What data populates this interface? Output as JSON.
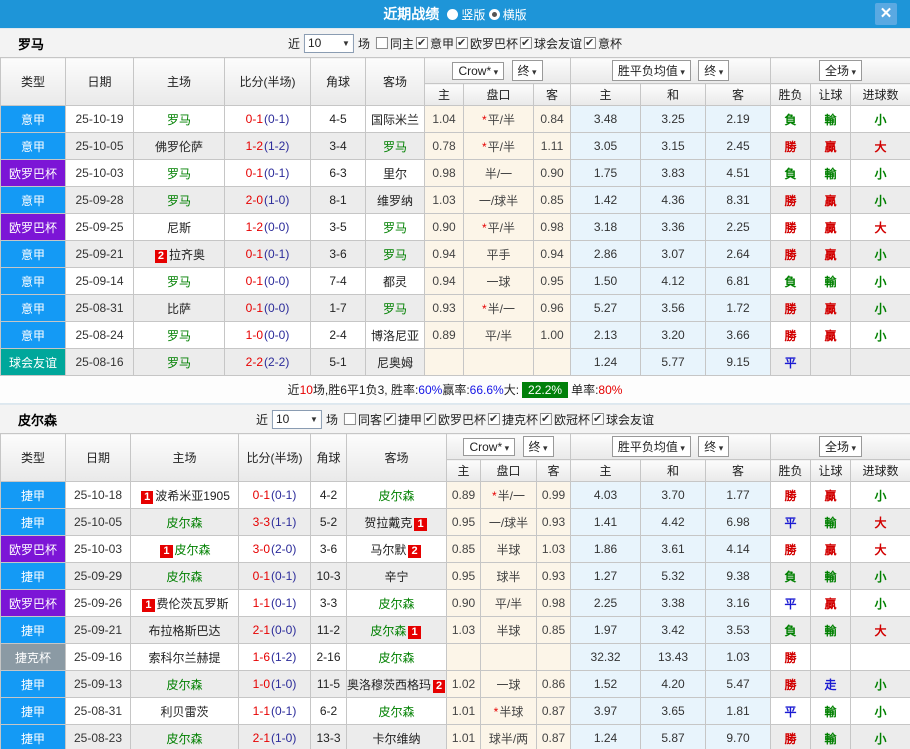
{
  "titlebar": {
    "title": "近期战绩",
    "layout_options": [
      {
        "label": "竖版",
        "checked": false
      },
      {
        "label": "横版",
        "checked": true
      }
    ],
    "close": "✕"
  },
  "table_header": {
    "type": "类型",
    "date": "日期",
    "home": "主场",
    "score": "比分(半场)",
    "corner": "角球",
    "away": "客场",
    "crow": "Crow*",
    "final": "终",
    "avg": "胜平负均值",
    "fullmatch": "全场",
    "h1": "主",
    "hcap": "盘口",
    "a1": "客",
    "h2": "主",
    "d": "和",
    "a2": "客",
    "wl": "胜负",
    "rg": "让球",
    "goals": "进球数"
  },
  "league_colors": {
    "意甲": "#149af5",
    "捷甲": "#149af5",
    "欧罗巴杯": "#7c15d6",
    "球会友谊": "#00a79b",
    "捷克杯": "#8b9aa4"
  },
  "result_colors": {
    "win": "#d20000",
    "lose": "#008000",
    "draw": "#1a1ad2"
  },
  "sections": [
    {
      "team": "罗马",
      "near": "近",
      "count": "10",
      "matches": "场",
      "filters": [
        {
          "label": "同主",
          "checked": false
        },
        {
          "label": "意甲",
          "checked": true
        },
        {
          "label": "欧罗巴杯",
          "checked": true
        },
        {
          "label": "球会友谊",
          "checked": true
        },
        {
          "label": "意杯",
          "checked": true
        }
      ],
      "rows": [
        {
          "league": "意甲",
          "date": "25-10-19",
          "home": {
            "name": "罗马",
            "green": true,
            "badge": ""
          },
          "ft": "0-1",
          "ht": "0-1",
          "corner": "4-5",
          "away": {
            "name": "国际米兰",
            "green": false,
            "badge": ""
          },
          "o1": "1.04",
          "star": true,
          "hcap": "平/半",
          "o2": "0.84",
          "a1": "3.48",
          "a2": "3.25",
          "a3": "2.19",
          "r1": "負",
          "r2": "輸",
          "r3": "小"
        },
        {
          "league": "意甲",
          "date": "25-10-05",
          "home": {
            "name": "佛罗伦萨",
            "green": false,
            "badge": ""
          },
          "ft": "1-2",
          "ht": "1-2",
          "corner": "3-4",
          "away": {
            "name": "罗马",
            "green": true,
            "badge": ""
          },
          "o1": "0.78",
          "star": true,
          "hcap": "平/半",
          "o2": "1.11",
          "a1": "3.05",
          "a2": "3.15",
          "a3": "2.45",
          "r1": "勝",
          "r2": "贏",
          "r3": "大"
        },
        {
          "league": "欧罗巴杯",
          "date": "25-10-03",
          "home": {
            "name": "罗马",
            "green": true,
            "badge": ""
          },
          "ft": "0-1",
          "ht": "0-1",
          "corner": "6-3",
          "away": {
            "name": "里尔",
            "green": false,
            "badge": ""
          },
          "o1": "0.98",
          "star": false,
          "hcap": "半/一",
          "o2": "0.90",
          "a1": "1.75",
          "a2": "3.83",
          "a3": "4.51",
          "r1": "負",
          "r2": "輸",
          "r3": "小"
        },
        {
          "league": "意甲",
          "date": "25-09-28",
          "home": {
            "name": "罗马",
            "green": true,
            "badge": ""
          },
          "ft": "2-0",
          "ht": "1-0",
          "corner": "8-1",
          "away": {
            "name": "维罗纳",
            "green": false,
            "badge": ""
          },
          "o1": "1.03",
          "star": false,
          "hcap": "一/球半",
          "o2": "0.85",
          "a1": "1.42",
          "a2": "4.36",
          "a3": "8.31",
          "r1": "勝",
          "r2": "贏",
          "r3": "小"
        },
        {
          "league": "欧罗巴杯",
          "date": "25-09-25",
          "home": {
            "name": "尼斯",
            "green": false,
            "badge": ""
          },
          "ft": "1-2",
          "ht": "0-0",
          "corner": "3-5",
          "away": {
            "name": "罗马",
            "green": true,
            "badge": ""
          },
          "o1": "0.90",
          "star": true,
          "hcap": "平/半",
          "o2": "0.98",
          "a1": "3.18",
          "a2": "3.36",
          "a3": "2.25",
          "r1": "勝",
          "r2": "贏",
          "r3": "大"
        },
        {
          "league": "意甲",
          "date": "25-09-21",
          "home": {
            "name": "拉齐奥",
            "green": false,
            "badge": "2"
          },
          "ft": "0-1",
          "ht": "0-1",
          "corner": "3-6",
          "away": {
            "name": "罗马",
            "green": true,
            "badge": ""
          },
          "o1": "0.94",
          "star": false,
          "hcap": "平手",
          "o2": "0.94",
          "a1": "2.86",
          "a2": "3.07",
          "a3": "2.64",
          "r1": "勝",
          "r2": "贏",
          "r3": "小"
        },
        {
          "league": "意甲",
          "date": "25-09-14",
          "home": {
            "name": "罗马",
            "green": true,
            "badge": ""
          },
          "ft": "0-1",
          "ht": "0-0",
          "corner": "7-4",
          "away": {
            "name": "都灵",
            "green": false,
            "badge": ""
          },
          "o1": "0.94",
          "star": false,
          "hcap": "一球",
          "o2": "0.95",
          "a1": "1.50",
          "a2": "4.12",
          "a3": "6.81",
          "r1": "負",
          "r2": "輸",
          "r3": "小"
        },
        {
          "league": "意甲",
          "date": "25-08-31",
          "home": {
            "name": "比萨",
            "green": false,
            "badge": ""
          },
          "ft": "0-1",
          "ht": "0-0",
          "corner": "1-7",
          "away": {
            "name": "罗马",
            "green": true,
            "badge": ""
          },
          "o1": "0.93",
          "star": true,
          "hcap": "半/一",
          "o2": "0.96",
          "a1": "5.27",
          "a2": "3.56",
          "a3": "1.72",
          "r1": "勝",
          "r2": "贏",
          "r3": "小"
        },
        {
          "league": "意甲",
          "date": "25-08-24",
          "home": {
            "name": "罗马",
            "green": true,
            "badge": ""
          },
          "ft": "1-0",
          "ht": "0-0",
          "corner": "2-4",
          "away": {
            "name": "博洛尼亚",
            "green": false,
            "badge": ""
          },
          "o1": "0.89",
          "star": false,
          "hcap": "平/半",
          "o2": "1.00",
          "a1": "2.13",
          "a2": "3.20",
          "a3": "3.66",
          "r1": "勝",
          "r2": "贏",
          "r3": "小"
        },
        {
          "league": "球会友谊",
          "date": "25-08-16",
          "home": {
            "name": "罗马",
            "green": true,
            "badge": ""
          },
          "ft": "2-2",
          "ht": "2-2",
          "corner": "5-1",
          "away": {
            "name": "尼奥姆",
            "green": false,
            "badge": ""
          },
          "o1": "",
          "star": false,
          "hcap": "",
          "o2": "",
          "a1": "1.24",
          "a2": "5.77",
          "a3": "9.15",
          "r1": "平",
          "r2": "",
          "r3": ""
        }
      ],
      "summary": {
        "t1": "近",
        "n1": "10",
        "t2": "场,胜6平1负3, 胜率:",
        "v1": "60%",
        "t3": " 赢率:",
        "v2": "66.6%",
        "t4": " 大:",
        "v3": "22.2%",
        "t5": " 单率:",
        "v4": "80%"
      }
    },
    {
      "team": "皮尔森",
      "near": "近",
      "count": "10",
      "matches": "场",
      "filters": [
        {
          "label": "同客",
          "checked": false
        },
        {
          "label": "捷甲",
          "checked": true
        },
        {
          "label": "欧罗巴杯",
          "checked": true
        },
        {
          "label": "捷克杯",
          "checked": true
        },
        {
          "label": "欧冠杯",
          "checked": true
        },
        {
          "label": "球会友谊",
          "checked": true
        }
      ],
      "rows": [
        {
          "league": "捷甲",
          "date": "25-10-18",
          "home": {
            "name": "波希米亚1905",
            "green": false,
            "badge": "1"
          },
          "ft": "0-1",
          "ht": "0-1",
          "corner": "4-2",
          "away": {
            "name": "皮尔森",
            "green": true,
            "badge": ""
          },
          "o1": "0.89",
          "star": true,
          "hcap": "半/一",
          "o2": "0.99",
          "a1": "4.03",
          "a2": "3.70",
          "a3": "1.77",
          "r1": "勝",
          "r2": "贏",
          "r3": "小"
        },
        {
          "league": "捷甲",
          "date": "25-10-05",
          "home": {
            "name": "皮尔森",
            "green": true,
            "badge": ""
          },
          "ft": "3-3",
          "ht": "1-1",
          "corner": "5-2",
          "away": {
            "name": "贺拉戴克",
            "green": false,
            "badge": "1"
          },
          "o1": "0.95",
          "star": false,
          "hcap": "一/球半",
          "o2": "0.93",
          "a1": "1.41",
          "a2": "4.42",
          "a3": "6.98",
          "r1": "平",
          "r2": "輸",
          "r3": "大"
        },
        {
          "league": "欧罗巴杯",
          "date": "25-10-03",
          "home": {
            "name": "皮尔森",
            "green": true,
            "badge": "1"
          },
          "ft": "3-0",
          "ht": "2-0",
          "corner": "3-6",
          "away": {
            "name": "马尔默",
            "green": false,
            "badge": "2"
          },
          "o1": "0.85",
          "star": false,
          "hcap": "半球",
          "o2": "1.03",
          "a1": "1.86",
          "a2": "3.61",
          "a3": "4.14",
          "r1": "勝",
          "r2": "贏",
          "r3": "大"
        },
        {
          "league": "捷甲",
          "date": "25-09-29",
          "home": {
            "name": "皮尔森",
            "green": true,
            "badge": ""
          },
          "ft": "0-1",
          "ht": "0-1",
          "corner": "10-3",
          "away": {
            "name": "辛宁",
            "green": false,
            "badge": ""
          },
          "o1": "0.95",
          "star": false,
          "hcap": "球半",
          "o2": "0.93",
          "a1": "1.27",
          "a2": "5.32",
          "a3": "9.38",
          "r1": "負",
          "r2": "輸",
          "r3": "小"
        },
        {
          "league": "欧罗巴杯",
          "date": "25-09-26",
          "home": {
            "name": "费伦茨瓦罗斯",
            "green": false,
            "badge": "1"
          },
          "ft": "1-1",
          "ht": "0-1",
          "corner": "3-3",
          "away": {
            "name": "皮尔森",
            "green": true,
            "badge": ""
          },
          "o1": "0.90",
          "star": false,
          "hcap": "平/半",
          "o2": "0.98",
          "a1": "2.25",
          "a2": "3.38",
          "a3": "3.16",
          "r1": "平",
          "r2": "贏",
          "r3": "小"
        },
        {
          "league": "捷甲",
          "date": "25-09-21",
          "home": {
            "name": "布拉格斯巴达",
            "green": false,
            "badge": ""
          },
          "ft": "2-1",
          "ht": "0-0",
          "corner": "11-2",
          "away": {
            "name": "皮尔森",
            "green": true,
            "badge": "1"
          },
          "o1": "1.03",
          "star": false,
          "hcap": "半球",
          "o2": "0.85",
          "a1": "1.97",
          "a2": "3.42",
          "a3": "3.53",
          "r1": "負",
          "r2": "輸",
          "r3": "大"
        },
        {
          "league": "捷克杯",
          "date": "25-09-16",
          "home": {
            "name": "索科尔兰赫提",
            "green": false,
            "badge": ""
          },
          "ft": "1-6",
          "ht": "1-2",
          "corner": "2-16",
          "away": {
            "name": "皮尔森",
            "green": true,
            "badge": ""
          },
          "o1": "",
          "star": false,
          "hcap": "",
          "o2": "",
          "a1": "32.32",
          "a2": "13.43",
          "a3": "1.03",
          "r1": "勝",
          "r2": "",
          "r3": ""
        },
        {
          "league": "捷甲",
          "date": "25-09-13",
          "home": {
            "name": "皮尔森",
            "green": true,
            "badge": ""
          },
          "ft": "1-0",
          "ht": "1-0",
          "corner": "11-5",
          "away": {
            "name": "奥洛穆茨西格玛",
            "green": false,
            "badge": "2"
          },
          "o1": "1.02",
          "star": false,
          "hcap": "一球",
          "o2": "0.86",
          "a1": "1.52",
          "a2": "4.20",
          "a3": "5.47",
          "r1": "勝",
          "r2": "走",
          "r3": "小"
        },
        {
          "league": "捷甲",
          "date": "25-08-31",
          "home": {
            "name": "利贝雷茨",
            "green": false,
            "badge": ""
          },
          "ft": "1-1",
          "ht": "0-1",
          "corner": "6-2",
          "away": {
            "name": "皮尔森",
            "green": true,
            "badge": ""
          },
          "o1": "1.01",
          "star": true,
          "hcap": "半球",
          "o2": "0.87",
          "a1": "3.97",
          "a2": "3.65",
          "a3": "1.81",
          "r1": "平",
          "r2": "輸",
          "r3": "小"
        },
        {
          "league": "捷甲",
          "date": "25-08-23",
          "home": {
            "name": "皮尔森",
            "green": true,
            "badge": ""
          },
          "ft": "2-1",
          "ht": "1-0",
          "corner": "13-3",
          "away": {
            "name": "卡尔维纳",
            "green": false,
            "badge": ""
          },
          "o1": "1.01",
          "star": false,
          "hcap": "球半/两",
          "o2": "0.87",
          "a1": "1.24",
          "a2": "5.87",
          "a3": "9.70",
          "r1": "勝",
          "r2": "輸",
          "r3": "小"
        }
      ],
      "summary": null
    }
  ]
}
